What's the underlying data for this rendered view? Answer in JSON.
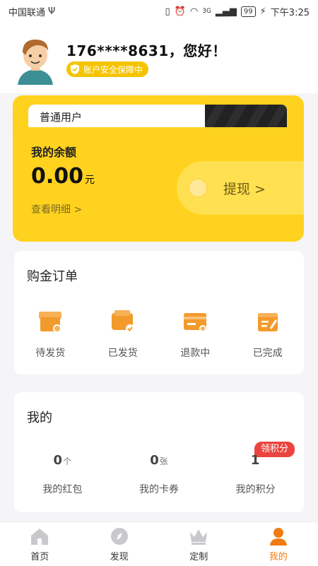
{
  "status_bar": {
    "carrier": "中国联通",
    "usb": "Ψ",
    "network": "3G",
    "battery": "99",
    "time": "下午3:25"
  },
  "header": {
    "greeting": "176****8631，您好！",
    "security_badge": "账户安全保障中"
  },
  "balance_card": {
    "tier": "普通用户",
    "title": "我的余额",
    "amount": "0.00",
    "unit": "元",
    "detail_link": "查看明细 >",
    "withdraw_label": "提现 >"
  },
  "orders": {
    "title": "购金订单",
    "items": [
      {
        "label": "待发货",
        "icon": "box-icon"
      },
      {
        "label": "已发货",
        "icon": "wallet-check-icon"
      },
      {
        "label": "退款中",
        "icon": "card-refund-icon"
      },
      {
        "label": "已完成",
        "icon": "done-icon"
      }
    ]
  },
  "mine": {
    "title": "我的",
    "points_badge": "领积分",
    "items": [
      {
        "value": "0",
        "unit": "个",
        "label": "我的红包"
      },
      {
        "value": "0",
        "unit": "张",
        "label": "我的卡券"
      },
      {
        "value": "1",
        "unit": "",
        "label": "我的积分"
      }
    ]
  },
  "tabbar": {
    "tabs": [
      {
        "label": "首页",
        "icon": "home-icon",
        "active": false
      },
      {
        "label": "发现",
        "icon": "compass-icon",
        "active": false
      },
      {
        "label": "定制",
        "icon": "crown-icon",
        "active": false
      },
      {
        "label": "我的",
        "icon": "user-icon",
        "active": true
      }
    ]
  },
  "colors": {
    "accent": "#ffd21f",
    "active_tab": "#f27c12",
    "order_icon": "#f39a2c",
    "badge": "#e9453e"
  }
}
